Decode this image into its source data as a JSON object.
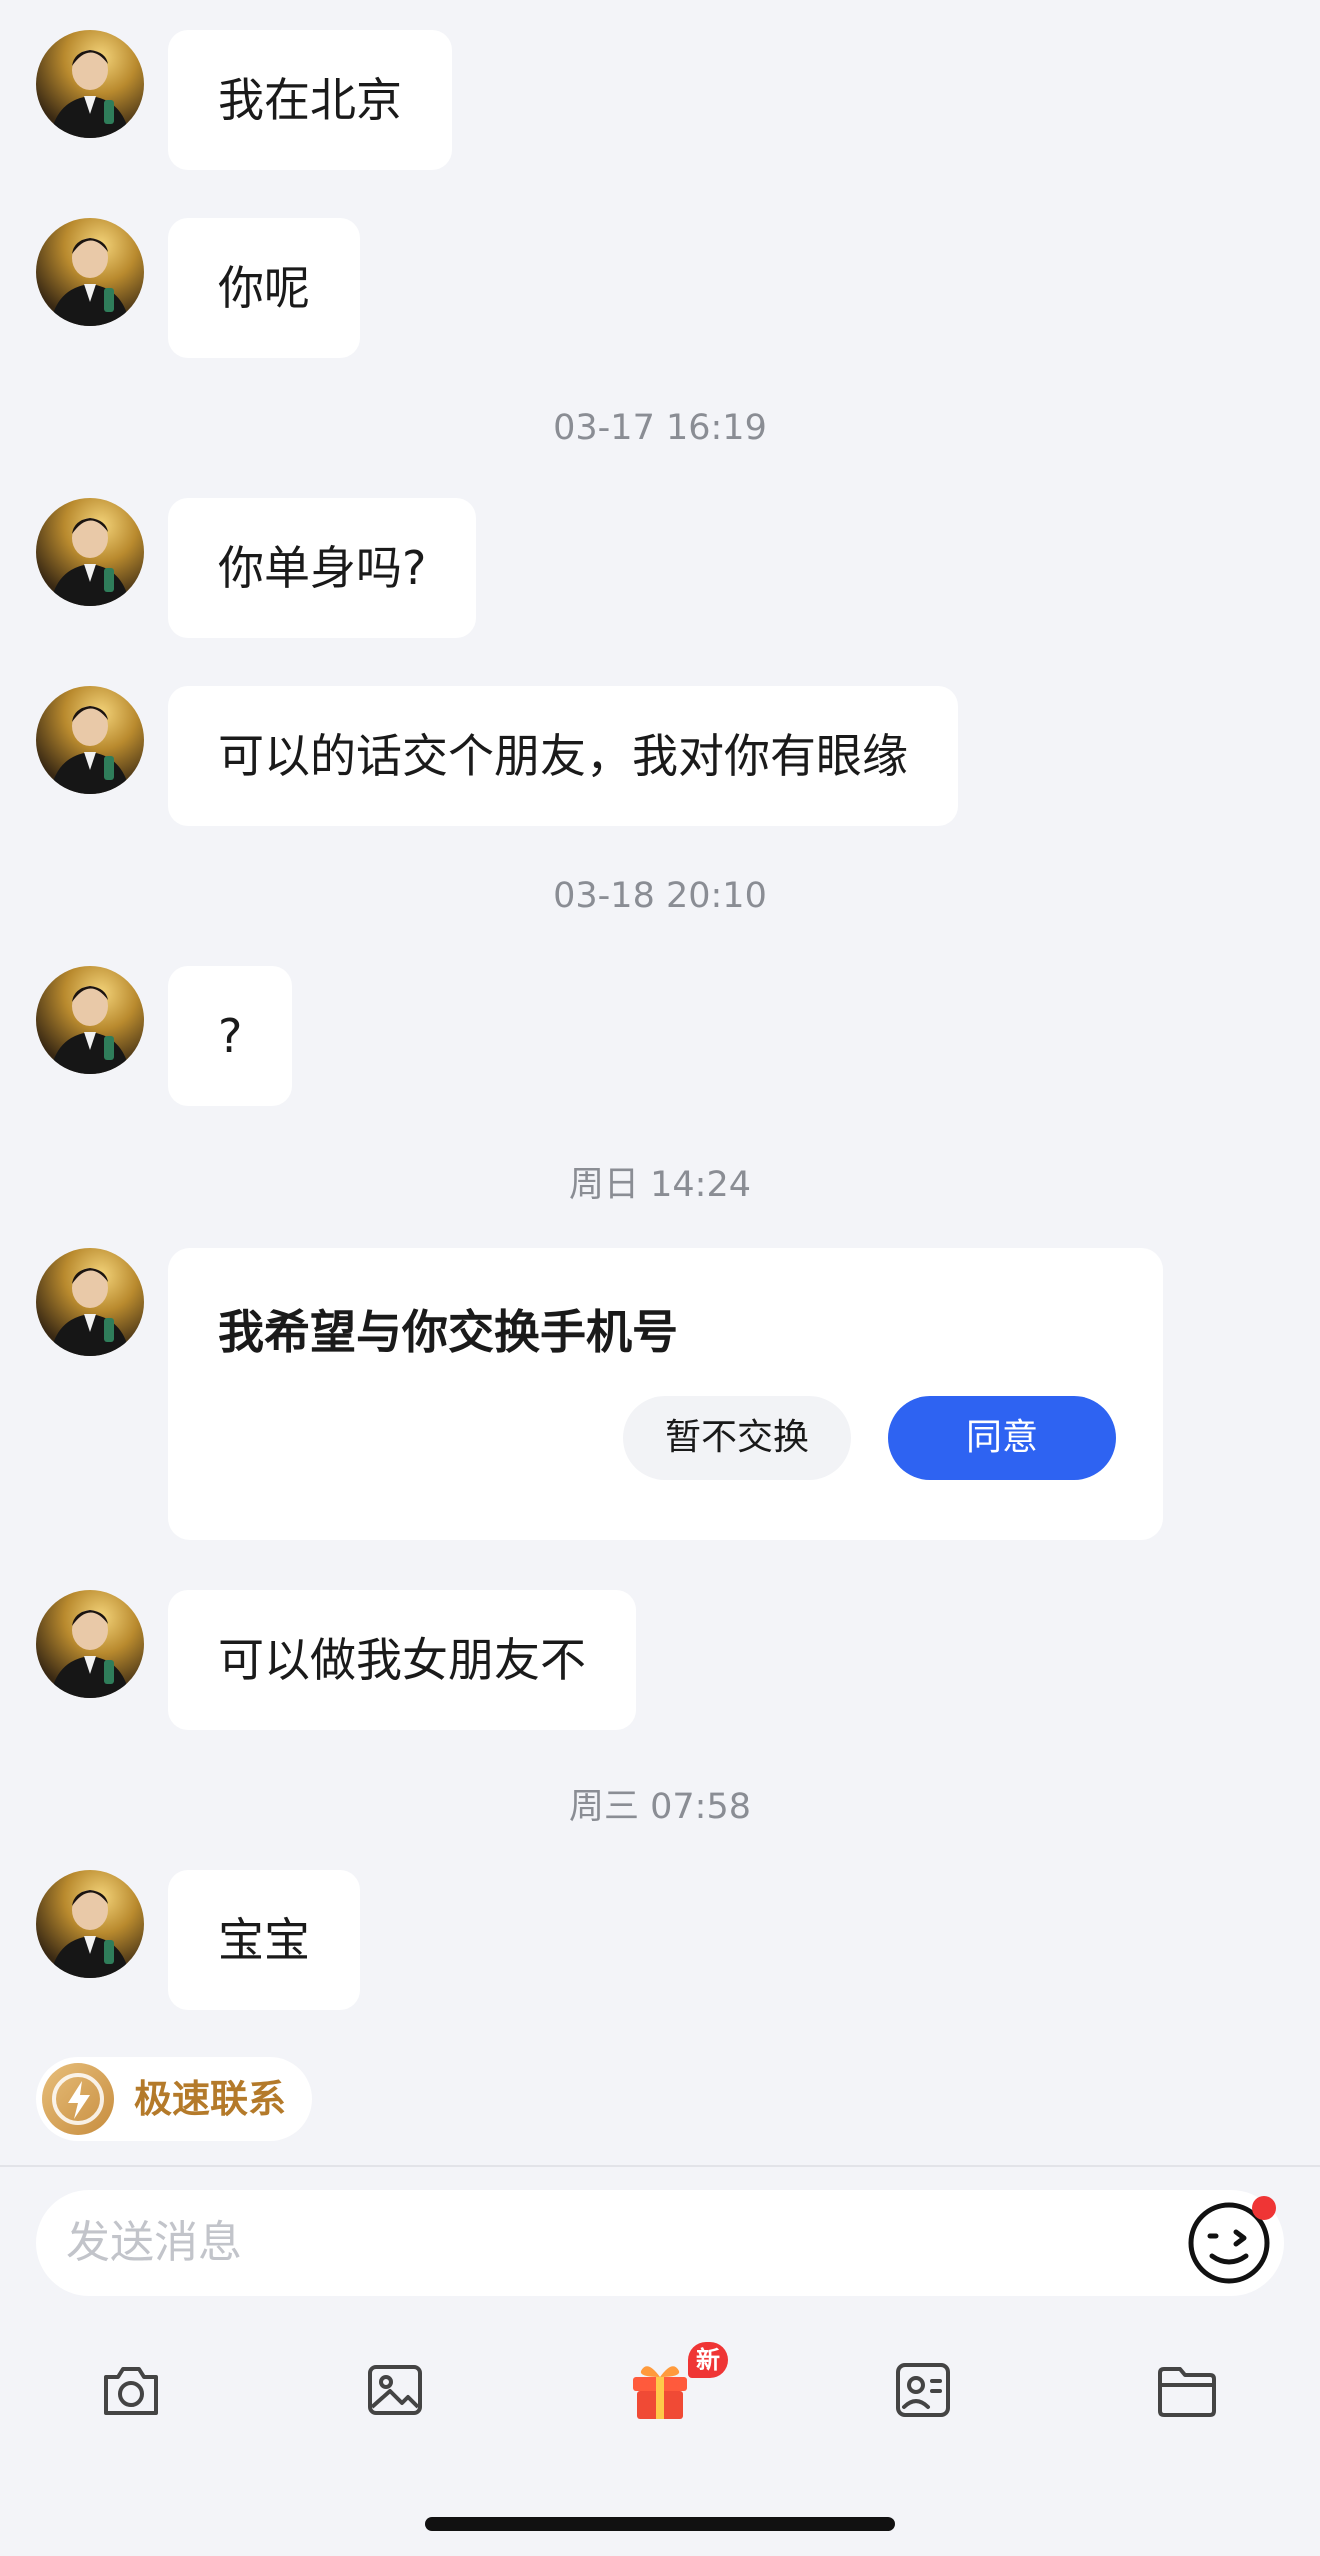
{
  "messages": [
    {
      "text": "我在北京"
    },
    {
      "text": "你呢"
    },
    {
      "text": "你单身吗?"
    },
    {
      "text": "可以的话交个朋友，我对你有眼缘"
    },
    {
      "text": "?"
    },
    {
      "text": "可以做我女朋友不"
    },
    {
      "text": "宝宝"
    }
  ],
  "timestamps": [
    "03-17 16:19",
    "03-18 20:10",
    "周日 14:24",
    "周三 07:58"
  ],
  "exchange_card": {
    "text": "我希望与你交换手机号",
    "decline_label": "暂不交换",
    "agree_label": "同意"
  },
  "quick_contact": {
    "label": "极速联系"
  },
  "composer": {
    "placeholder": "发送消息"
  },
  "toolbar": {
    "icons": [
      "camera-icon",
      "image-icon",
      "gift-icon",
      "contact-card-icon",
      "folder-icon"
    ],
    "gift_badge": "新"
  },
  "colors": {
    "accent": "#2e63f2",
    "badge": "#ef3535",
    "quick_contact": "#b47a2a"
  }
}
